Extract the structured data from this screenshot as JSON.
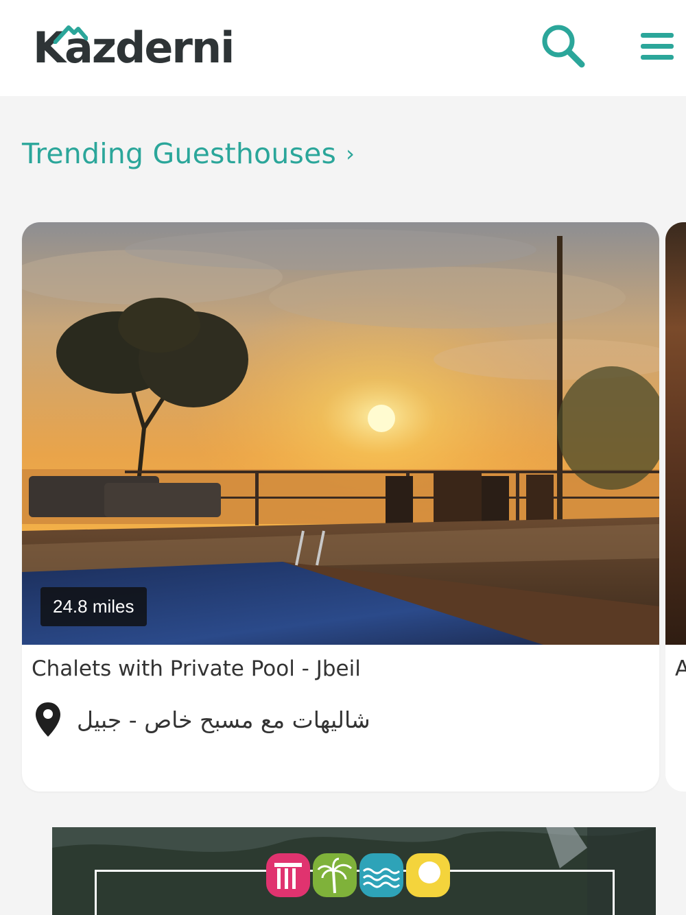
{
  "header": {
    "logo_text": "Kazderni",
    "brand_color": "#2ba69a",
    "search_icon": "search-icon",
    "menu_icon": "hamburger-menu-icon"
  },
  "section": {
    "title": "Trending Guesthouses",
    "chevron": "›"
  },
  "cards": [
    {
      "distance": "24.8 miles",
      "title": "Chalets with Private Pool - Jbeil",
      "location": "شاليهات مع مسبح خاص - جبيل",
      "image": "sunset-pool-terrace-photo"
    },
    {
      "title": "A",
      "image": "wooden-interior-photo"
    }
  ],
  "banner": {
    "icons": [
      {
        "name": "ruins-icon",
        "color": "#e0336f"
      },
      {
        "name": "palm-tree-icon",
        "color": "#7fb23a"
      },
      {
        "name": "sea-waves-icon",
        "color": "#2ea3b8"
      },
      {
        "name": "sun-icon",
        "color": "#f4d43c"
      }
    ]
  }
}
